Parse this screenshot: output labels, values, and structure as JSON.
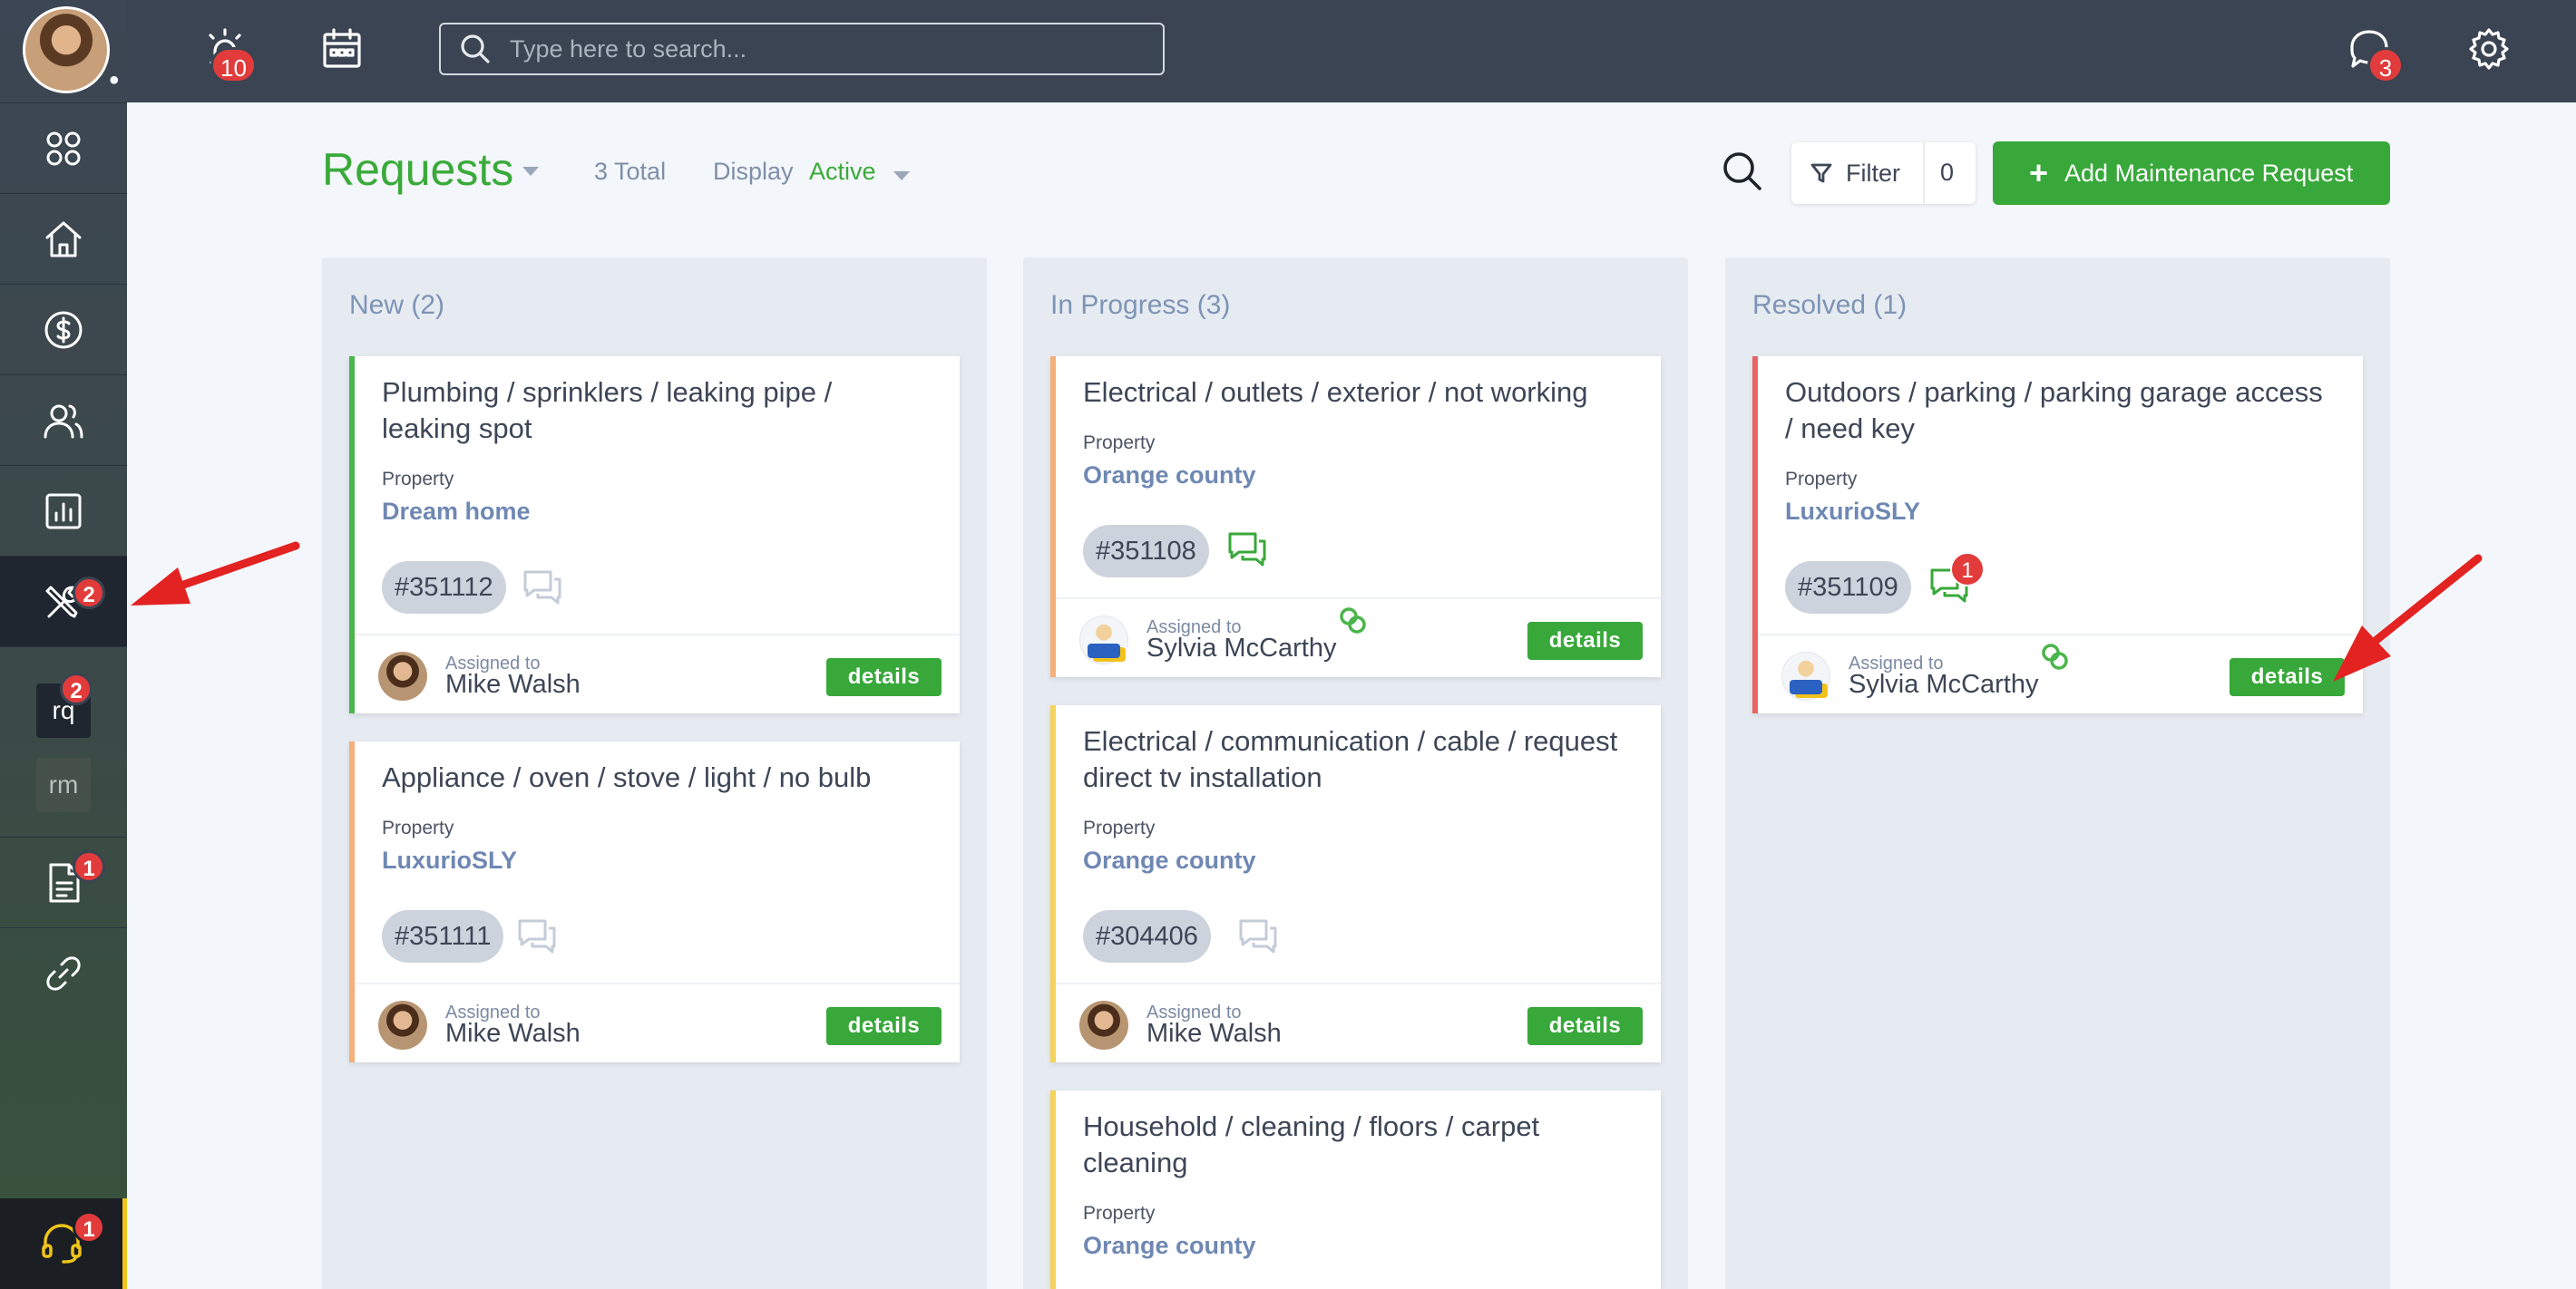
{
  "topbar": {
    "alarm_badge": "10",
    "search_placeholder": "Type here to search...",
    "messages_badge": "3"
  },
  "sidebar": {
    "items": [
      {
        "name": "dashboard",
        "icon": "grid-icon"
      },
      {
        "name": "home",
        "icon": "home-icon"
      },
      {
        "name": "accounting",
        "icon": "dollar-icon"
      },
      {
        "name": "people",
        "icon": "users-icon"
      },
      {
        "name": "reports",
        "icon": "chart-icon"
      },
      {
        "name": "maintenance",
        "icon": "tools-icon",
        "badge": "2"
      },
      {
        "name": "documents",
        "icon": "document-icon",
        "badge": "1"
      },
      {
        "name": "links",
        "icon": "link-icon"
      }
    ],
    "sub_items": [
      {
        "label": "rq",
        "badge": "2"
      },
      {
        "label": "rm"
      }
    ],
    "support_badge": "1"
  },
  "header": {
    "title": "Requests",
    "total": "3 Total",
    "display_label": "Display",
    "display_value": "Active",
    "filter_label": "Filter",
    "filter_count": "0",
    "add_label": "Add Maintenance Request"
  },
  "columns": [
    {
      "title": "New (2)",
      "cards": [
        {
          "title": "Plumbing / sprinklers / leaking pipe / leaking spot",
          "property_label": "Property",
          "property": "Dream home",
          "id": "#351112",
          "assigned_label": "Assigned to",
          "assignee": "Mike Walsh",
          "details": "details",
          "accent": "#4ab54a"
        },
        {
          "title": "Appliance / oven / stove / light / no bulb",
          "property_label": "Property",
          "property": "LuxurioSLY",
          "id": "#351111",
          "assigned_label": "Assigned to",
          "assignee": "Mike Walsh",
          "details": "details",
          "accent": "#f5b07a"
        }
      ]
    },
    {
      "title": "In Progress (3)",
      "cards": [
        {
          "title": "Electrical / outlets / exterior / not working",
          "property_label": "Property",
          "property": "Orange county",
          "id": "#351108",
          "assigned_label": "Assigned to",
          "assignee": "Sylvia McCarthy",
          "details": "details",
          "accent": "#f5b07a"
        },
        {
          "title": "Electrical / communication / cable / request direct tv installation",
          "property_label": "Property",
          "property": "Orange county",
          "id": "#304406",
          "assigned_label": "Assigned to",
          "assignee": "Mike Walsh",
          "details": "details",
          "accent": "#f5d35a"
        },
        {
          "title": "Household / cleaning / floors / carpet cleaning",
          "property_label": "Property",
          "property": "Orange county",
          "accent": "#f5d35a"
        }
      ]
    },
    {
      "title": "Resolved (1)",
      "cards": [
        {
          "title": "Outdoors / parking / parking garage access / need key",
          "property_label": "Property",
          "property": "LuxurioSLY",
          "id": "#351109",
          "chat_badge": "1",
          "assigned_label": "Assigned to",
          "assignee": "Sylvia McCarthy",
          "details": "details",
          "accent": "#e86464"
        }
      ]
    }
  ],
  "colors": {
    "green": "#38a83a",
    "badge_red": "#e23b3b",
    "annotation_arrow": "#e32222"
  }
}
